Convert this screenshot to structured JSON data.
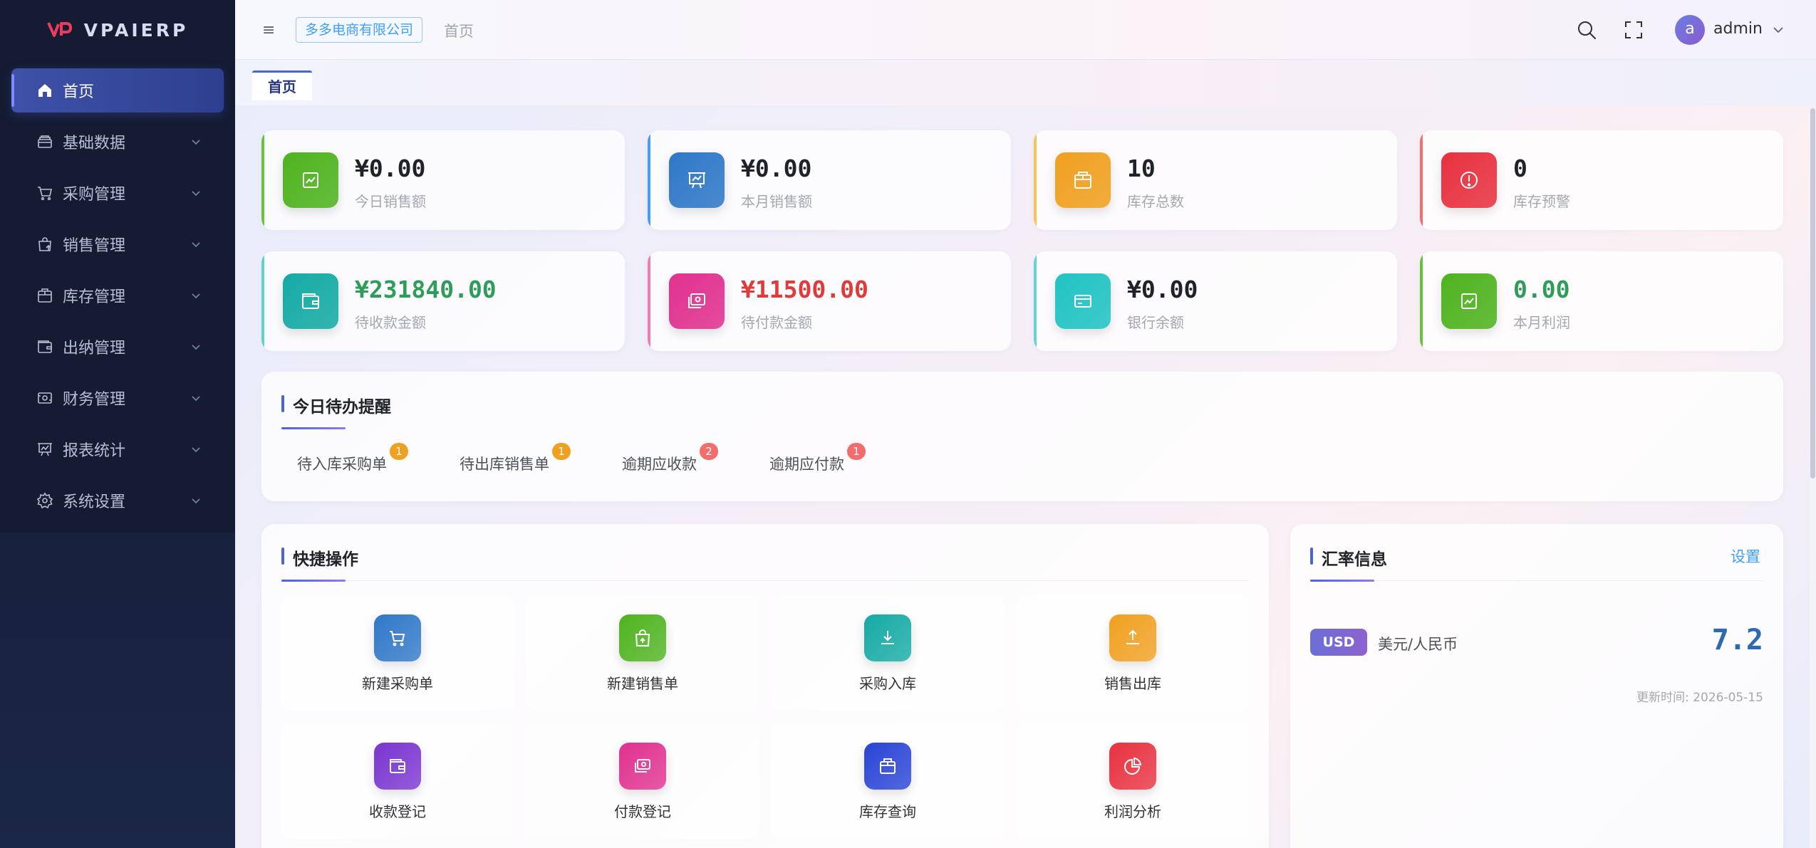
{
  "brand": {
    "name": "VPAIERP"
  },
  "sidebar": {
    "items": [
      {
        "label": "首页",
        "icon": "home-icon",
        "active": true
      },
      {
        "label": "基础数据",
        "icon": "database-icon"
      },
      {
        "label": "采购管理",
        "icon": "cart-icon"
      },
      {
        "label": "销售管理",
        "icon": "shopping-bag-icon"
      },
      {
        "label": "库存管理",
        "icon": "box-icon"
      },
      {
        "label": "出纳管理",
        "icon": "wallet-icon"
      },
      {
        "label": "财务管理",
        "icon": "money-icon"
      },
      {
        "label": "报表统计",
        "icon": "presentation-chart-icon"
      },
      {
        "label": "系统设置",
        "icon": "gear-icon"
      }
    ]
  },
  "header": {
    "company": "多多电商有限公司",
    "breadcrumb": "首页",
    "user_initial": "a",
    "user_name": "admin"
  },
  "tabs": [
    {
      "label": "首页"
    }
  ],
  "stats": [
    {
      "value": "¥0.00",
      "label": "今日销售额",
      "color": "#4fb31f",
      "accent": "#67c23a",
      "value_color": "#1f2329"
    },
    {
      "value": "¥0.00",
      "label": "本月销售额",
      "color": "#2f78c8",
      "accent": "#409eff",
      "value_color": "#1f2329"
    },
    {
      "value": "10",
      "label": "库存总数",
      "color": "#f0a020",
      "accent": "#f6c651",
      "value_color": "#1f2329"
    },
    {
      "value": "0",
      "label": "库存预警",
      "color": "#e8313f",
      "accent": "#f56c6c",
      "value_color": "#1f2329"
    },
    {
      "value": "¥231840.00",
      "label": "待收款金额",
      "color": "#15aaa5",
      "accent": "#5fd2c8",
      "value_color": "#2f9d5a"
    },
    {
      "value": "¥11500.00",
      "label": "待付款金额",
      "color": "#e0318f",
      "accent": "#f27ab2",
      "value_color": "#e03b3b"
    },
    {
      "value": "¥0.00",
      "label": "银行余额",
      "color": "#21c3c3",
      "accent": "#61d6d6",
      "value_color": "#1f2329"
    },
    {
      "value": "0.00",
      "label": "本月利润",
      "color": "#4fb31f",
      "accent": "#67c23a",
      "value_color": "#2f9d5a"
    }
  ],
  "todo": {
    "title": "今日待办提醒",
    "items": [
      {
        "label": "待入库采购单",
        "count": "1",
        "color": "#f0a020"
      },
      {
        "label": "待出库销售单",
        "count": "1",
        "color": "#f0a020"
      },
      {
        "label": "逾期应收款",
        "count": "2",
        "color": "#f56c6c"
      },
      {
        "label": "逾期应付款",
        "count": "1",
        "color": "#f56c6c"
      }
    ]
  },
  "quick": {
    "title": "快捷操作",
    "items": [
      {
        "label": "新建采购单",
        "icon": "cart-icon",
        "color": "#2f78c8"
      },
      {
        "label": "新建销售单",
        "icon": "shopping-bag-icon",
        "color": "#4fb31f"
      },
      {
        "label": "采购入库",
        "icon": "download-icon",
        "color": "#15aaa5"
      },
      {
        "label": "销售出库",
        "icon": "upload-icon",
        "color": "#f0a020"
      },
      {
        "label": "收款登记",
        "icon": "wallet-icon",
        "color": "#7a35d0"
      },
      {
        "label": "付款登记",
        "icon": "money-icon",
        "color": "#e0318f"
      },
      {
        "label": "库存查询",
        "icon": "box-icon",
        "color": "#2944d6"
      },
      {
        "label": "利润分析",
        "icon": "pie-chart-icon",
        "color": "#e8313f"
      }
    ]
  },
  "rates": {
    "title": "汇率信息",
    "settings_label": "设置",
    "currency_code": "USD",
    "currency_name": "美元/人民币",
    "value": "7.2",
    "updated_label": "更新时间:",
    "updated_value": "2026-05-15"
  }
}
